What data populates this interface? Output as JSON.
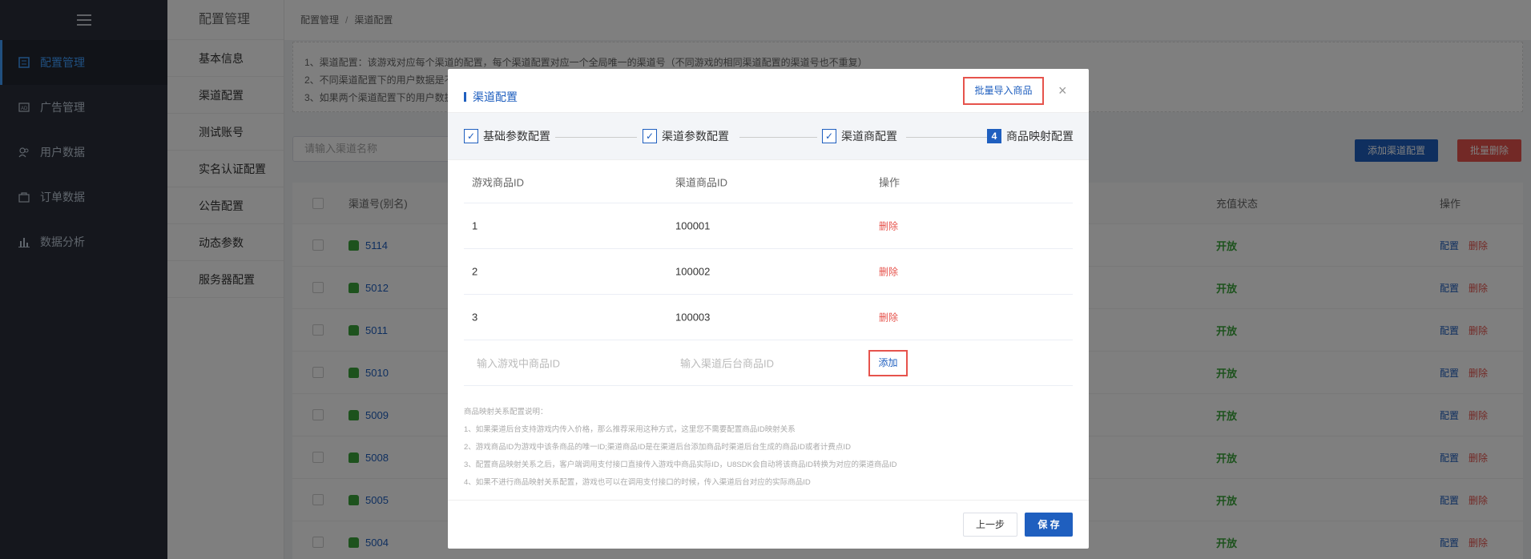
{
  "sidebar": {
    "toggle_icon": "menu-icon",
    "items": [
      {
        "label": "配置管理",
        "icon": "config-icon"
      },
      {
        "label": "广告管理",
        "icon": "ad-icon"
      },
      {
        "label": "用户数据",
        "icon": "users-icon"
      },
      {
        "label": "订单数据",
        "icon": "order-icon"
      },
      {
        "label": "数据分析",
        "icon": "chart-icon"
      }
    ]
  },
  "submenu": {
    "title": "配置管理",
    "items": [
      "基本信息",
      "渠道配置",
      "测试账号",
      "实名认证配置",
      "公告配置",
      "动态参数",
      "服务器配置"
    ]
  },
  "breadcrumb": {
    "root": "配置管理",
    "sep": "/",
    "current": "渠道配置"
  },
  "notice": {
    "lines": [
      "1、渠道配置：该游戏对应每个渠道的配置，每个渠道配置对应一个全局唯一的渠道号（不同游戏的相同渠道配置的渠道号也不重复）",
      "2、不同渠道配置下的用户数据是不",
      "3、如果两个渠道配置下的用户数据"
    ]
  },
  "search": {
    "placeholder": "请输入渠道名称"
  },
  "actions": {
    "add": "添加渠道配置",
    "batch_delete": "批量删除"
  },
  "table": {
    "headers": {
      "channel": "渠道号(别名)",
      "status": "充值状态",
      "ops": "操作"
    },
    "rows": [
      {
        "channel": "5114",
        "status": "开放"
      },
      {
        "channel": "5012",
        "status": "开放"
      },
      {
        "channel": "5011",
        "status": "开放"
      },
      {
        "channel": "5010",
        "status": "开放"
      },
      {
        "channel": "5009",
        "status": "开放"
      },
      {
        "channel": "5008",
        "status": "开放"
      },
      {
        "channel": "5005",
        "status": "开放"
      },
      {
        "channel": "5004",
        "status": "开放"
      }
    ],
    "op_config": "配置",
    "op_delete": "删除"
  },
  "modal": {
    "title": "渠道配置",
    "import_button": "批量导入商品",
    "close": "×",
    "steps": [
      {
        "label": "基础参数配置",
        "done": true
      },
      {
        "label": "渠道参数配置",
        "done": true
      },
      {
        "label": "渠道商配置",
        "done": true
      },
      {
        "label": "商品映射配置",
        "done": false,
        "num": "4"
      }
    ],
    "columns": {
      "game_id": "游戏商品ID",
      "channel_id": "渠道商品ID",
      "ops": "操作"
    },
    "rows": [
      {
        "game_id": "1",
        "channel_id": "100001",
        "op": "删除"
      },
      {
        "game_id": "2",
        "channel_id": "100002",
        "op": "删除"
      },
      {
        "game_id": "3",
        "channel_id": "100003",
        "op": "删除"
      }
    ],
    "input_game_placeholder": "输入游戏中商品ID",
    "input_channel_placeholder": "输入渠道后台商品ID",
    "add_button": "添加",
    "notes": [
      "商品映射关系配置说明：",
      "1、如果渠道后台支持游戏内传入价格，那么推荐采用这种方式，这里您不需要配置商品ID映射关系",
      "2、游戏商品ID为游戏中该条商品的唯一ID;渠道商品ID是在渠道后台添加商品时渠道后台生成的商品ID或者计费点ID",
      "3、配置商品映射关系之后，客户端调用支付接口直接传入游戏中商品实际ID，U8SDK会自动将该商品ID转换为对应的渠道商品ID",
      "4、如果不进行商品映射关系配置，游戏也可以在调用支付接口的时候，传入渠道后台对应的实际商品ID"
    ],
    "prev_button": "上一步",
    "save_button": "保 存"
  },
  "colors": {
    "primary": "#1f5fbf",
    "danger": "#e6534c",
    "success": "#3ba53b",
    "sidebar": "#2b2f3a"
  }
}
